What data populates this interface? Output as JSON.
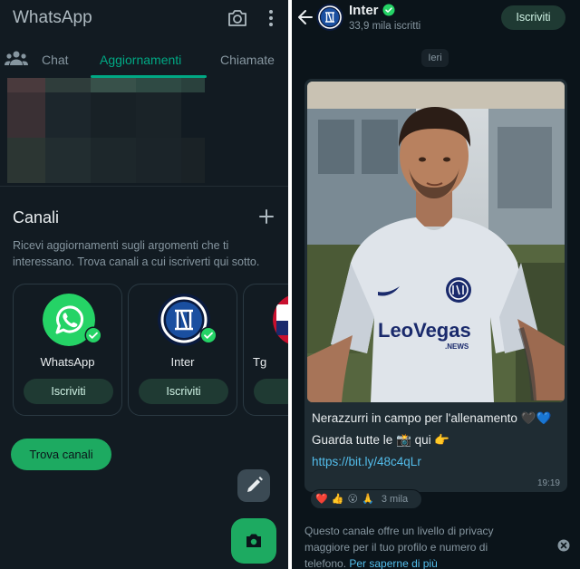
{
  "left": {
    "app_title": "WhatsApp",
    "icons": {
      "camera": "camera-icon",
      "more": "more-vertical-icon",
      "community": "community-icon"
    },
    "tabs": [
      {
        "label": "Chat",
        "active": false
      },
      {
        "label": "Aggiornamenti",
        "active": true
      },
      {
        "label": "Chiamate",
        "active": false
      }
    ],
    "channels": {
      "title": "Canali",
      "description": "Ricevi aggiornamenti sugli argomenti che ti interessano. Trova canali a cui iscriverti qui sotto.",
      "cards": [
        {
          "name": "WhatsApp",
          "button": "Iscriviti"
        },
        {
          "name": "Inter",
          "button": "Iscriviti"
        },
        {
          "name": "Tg",
          "button": "Is"
        }
      ],
      "find_button": "Trova canali"
    },
    "colors": {
      "accent": "#00a884",
      "button_green": "#1daa61"
    }
  },
  "right": {
    "channel_name": "Inter",
    "subscribers": "33,9 mila iscritti",
    "subscribe_button": "Iscriviti",
    "date_chip": "Ieri",
    "message": {
      "line1": "Nerazzurri in campo per l'allenamento 🖤💙",
      "line2_prefix": "Guarda tutte le 📸 qui 👉 ",
      "link": "https://bit.ly/48c4qLr",
      "time": "19:19",
      "photo_shirt_text": "LeoVegas.NEWS"
    },
    "reactions": {
      "emojis": [
        "❤️",
        "👍",
        "😮",
        "🙏"
      ],
      "count": "3 mila"
    },
    "privacy": {
      "text": "Questo canale offre un livello di privacy maggiore per il tuo profilo e numero di telefono. ",
      "link": "Per saperne di più"
    }
  }
}
